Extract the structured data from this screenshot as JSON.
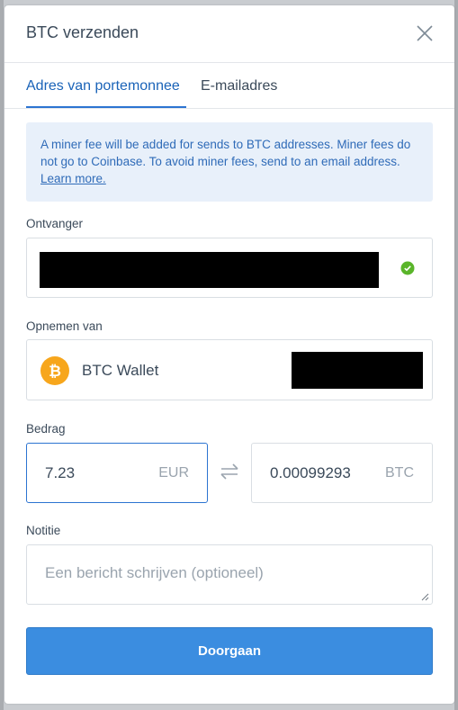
{
  "modal": {
    "title": "BTC verzenden"
  },
  "tabs": [
    {
      "label": "Adres van portemonnee",
      "active": true
    },
    {
      "label": "E-mailadres",
      "active": false
    }
  ],
  "notice": {
    "text": "A miner fee will be added for sends to BTC addresses. Miner fees do not go to Coinbase. To avoid miner fees, send to an email address.",
    "link": "Learn more."
  },
  "recipient": {
    "label": "Ontvanger",
    "status_icon": "check-valid-icon"
  },
  "from": {
    "label": "Opnemen van",
    "wallet_name": "BTC Wallet",
    "icon": "bitcoin-icon"
  },
  "amount": {
    "label": "Bedrag",
    "fiat_value": "7.23",
    "fiat_currency": "EUR",
    "crypto_value": "0.00099293",
    "crypto_currency": "BTC",
    "swap_icon": "swap-arrows-icon"
  },
  "note": {
    "label": "Notitie",
    "placeholder": "Een bericht schrijven (optioneel)"
  },
  "actions": {
    "continue_label": "Doorgaan"
  },
  "colors": {
    "accent": "#2c74d1",
    "button": "#3b8de0",
    "bitcoin": "#f7a61c",
    "valid": "#5ab52a"
  }
}
